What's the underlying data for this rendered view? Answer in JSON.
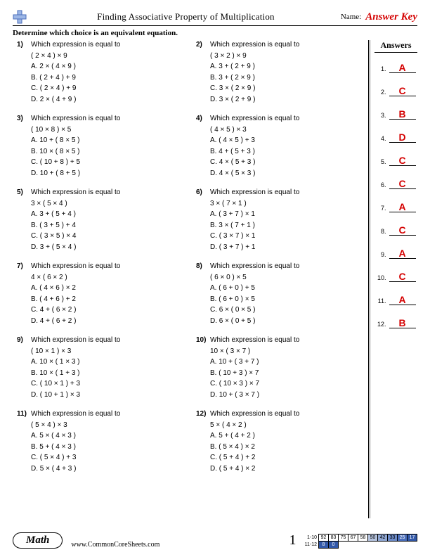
{
  "header": {
    "title": "Finding Associative Property of Multiplication",
    "name_label": "Name:",
    "answer_key": "Answer Key"
  },
  "instruction": "Determine which choice is an equivalent equation.",
  "answers_title": "Answers",
  "questions": [
    {
      "n": "1)",
      "stem": "Which expression is equal to",
      "expr": "( 2 × 4 ) × 9",
      "A": "2 × ( 4 × 9 )",
      "B": "( 2 + 4 ) + 9",
      "C": "( 2 × 4 ) + 9",
      "D": "2 × ( 4 + 9 )"
    },
    {
      "n": "2)",
      "stem": "Which expression is equal to",
      "expr": "( 3 × 2 ) × 9",
      "A": "3 + ( 2 + 9 )",
      "B": "3 + ( 2 × 9 )",
      "C": "3 × ( 2 × 9 )",
      "D": "3 × ( 2 + 9 )"
    },
    {
      "n": "3)",
      "stem": "Which expression is equal to",
      "expr": "( 10 × 8 ) × 5",
      "A": "10 + ( 8 × 5 )",
      "B": "10 × ( 8 × 5 )",
      "C": "( 10 + 8 ) + 5",
      "D": "10 + ( 8 + 5 )"
    },
    {
      "n": "4)",
      "stem": "Which expression is equal to",
      "expr": "( 4 × 5 ) × 3",
      "A": "( 4 × 5 ) + 3",
      "B": "4 + ( 5 + 3 )",
      "C": "4 × ( 5 + 3 )",
      "D": "4 × ( 5 × 3 )"
    },
    {
      "n": "5)",
      "stem": "Which expression is equal to",
      "expr": "3 × ( 5 × 4 )",
      "A": "3 + ( 5 + 4 )",
      "B": "( 3 + 5 ) + 4",
      "C": "( 3 × 5 ) × 4",
      "D": "3 + ( 5 × 4 )"
    },
    {
      "n": "6)",
      "stem": "Which expression is equal to",
      "expr": "3 × ( 7 × 1 )",
      "A": "( 3 + 7 ) × 1",
      "B": "3 × ( 7 + 1 )",
      "C": "( 3 × 7 ) × 1",
      "D": "( 3 + 7 ) + 1"
    },
    {
      "n": "7)",
      "stem": "Which expression is equal to",
      "expr": "4 × ( 6 × 2 )",
      "A": "( 4 × 6 ) × 2",
      "B": "( 4 + 6 ) + 2",
      "C": "4 + ( 6 × 2 )",
      "D": "4 + ( 6 + 2 )"
    },
    {
      "n": "8)",
      "stem": "Which expression is equal to",
      "expr": "( 6 × 0 ) × 5",
      "A": "( 6 + 0 ) + 5",
      "B": "( 6 + 0 ) × 5",
      "C": "6 × ( 0 × 5 )",
      "D": "6 × ( 0 + 5 )"
    },
    {
      "n": "9)",
      "stem": "Which expression is equal to",
      "expr": "( 10 × 1 ) × 3",
      "A": "10 × ( 1 × 3 )",
      "B": "10 × ( 1 + 3 )",
      "C": "( 10 × 1 ) + 3",
      "D": "( 10 + 1 ) × 3"
    },
    {
      "n": "10)",
      "stem": "Which expression is equal to",
      "expr": "10 × ( 3 × 7 )",
      "A": "10 + ( 3 + 7 )",
      "B": "( 10 + 3 ) × 7",
      "C": "( 10 × 3 ) × 7",
      "D": "10 + ( 3 × 7 )"
    },
    {
      "n": "11)",
      "stem": "Which expression is equal to",
      "expr": "( 5 × 4 ) × 3",
      "A": "5 × ( 4 × 3 )",
      "B": "5 + ( 4 × 3 )",
      "C": "( 5 × 4 ) + 3",
      "D": "5 × ( 4 + 3 )"
    },
    {
      "n": "12)",
      "stem": "Which expression is equal to",
      "expr": "5 × ( 4 × 2 )",
      "A": "5 + ( 4 + 2 )",
      "B": "( 5 × 4 ) × 2",
      "C": "( 5 + 4 ) + 2",
      "D": "( 5 + 4 ) × 2"
    }
  ],
  "answers": [
    {
      "n": "1.",
      "v": "A"
    },
    {
      "n": "2.",
      "v": "C"
    },
    {
      "n": "3.",
      "v": "B"
    },
    {
      "n": "4.",
      "v": "D"
    },
    {
      "n": "5.",
      "v": "C"
    },
    {
      "n": "6.",
      "v": "C"
    },
    {
      "n": "7.",
      "v": "A"
    },
    {
      "n": "8.",
      "v": "C"
    },
    {
      "n": "9.",
      "v": "A"
    },
    {
      "n": "10.",
      "v": "C"
    },
    {
      "n": "11.",
      "v": "A"
    },
    {
      "n": "12.",
      "v": "B"
    }
  ],
  "footer": {
    "subject": "Math",
    "site": "www.CommonCoreSheets.com",
    "page": "1",
    "score_rows": {
      "row1_label": "1-10",
      "row1": [
        "92",
        "83",
        "75",
        "67",
        "58",
        "50",
        "42",
        "33",
        "25",
        "17"
      ],
      "row2_label": "11-12",
      "row2": [
        "8",
        "0"
      ]
    }
  },
  "choice_prefix": {
    "A": "A.",
    "B": "B.",
    "C": "C.",
    "D": "D."
  }
}
